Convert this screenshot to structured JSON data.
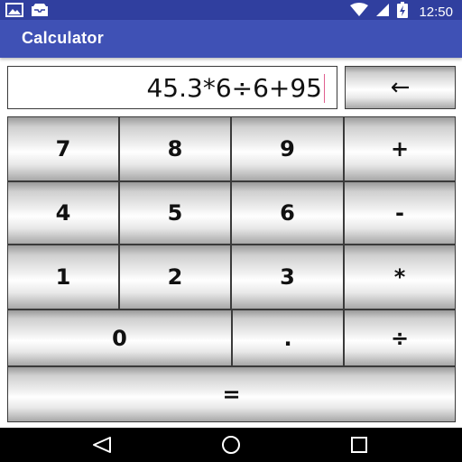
{
  "status_bar": {
    "time": "12:50",
    "left_icons": [
      "image-icon",
      "inbox-icon"
    ],
    "right_icons": [
      "wifi-icon",
      "cellular-icon",
      "battery-icon"
    ]
  },
  "app_bar": {
    "title": "Calculator"
  },
  "display": {
    "value": "45.3*6÷6+95"
  },
  "keypad": {
    "backspace": "←",
    "row1": [
      "7",
      "8",
      "9",
      "+"
    ],
    "row2": [
      "4",
      "5",
      "6",
      "-"
    ],
    "row3": [
      "1",
      "2",
      "3",
      "*"
    ],
    "row4": [
      "0",
      ".",
      "÷"
    ],
    "equals": "="
  },
  "nav_bar": {
    "icons": [
      "back-icon",
      "home-icon",
      "recents-icon"
    ]
  },
  "colors": {
    "status_bar": "#303f9f",
    "app_bar": "#3f51b5",
    "nav_bar": "#000000",
    "display_cursor": "#e06090"
  }
}
